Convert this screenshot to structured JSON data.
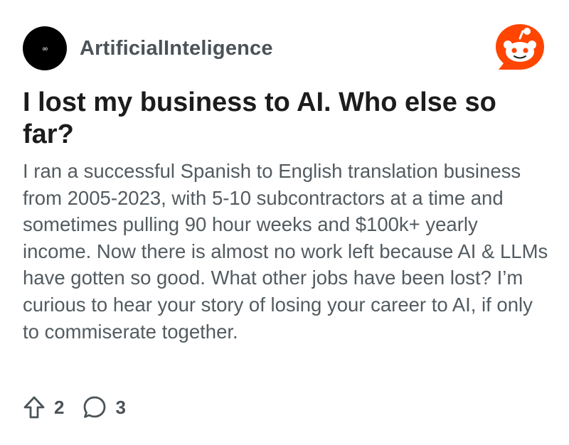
{
  "post": {
    "community": "ArtificialInteligence",
    "avatar_glyph": "∞",
    "title": "I lost my business to AI. Who else so far?",
    "body": "I ran a successful Spanish to English translation business from 2005-2023, with 5-10 subcontractors at a time and sometimes pulling 90 hour weeks and $100k+ yearly income. Now there is almost no work left because AI & LLMs have gotten so good. What other jobs have been lost? I’m curious to hear your story of losing your career to AI, if only to commiserate together.",
    "upvotes": "2",
    "comments": "3"
  },
  "icons": {
    "brand": "reddit-logo-icon",
    "upvote": "upvote-arrow-icon",
    "comment": "comment-bubble-icon"
  },
  "colors": {
    "reddit_orange": "#ff4500",
    "text_primary": "#1c1c1c",
    "text_secondary": "#535b60",
    "meta_gray": "#4b5358"
  }
}
